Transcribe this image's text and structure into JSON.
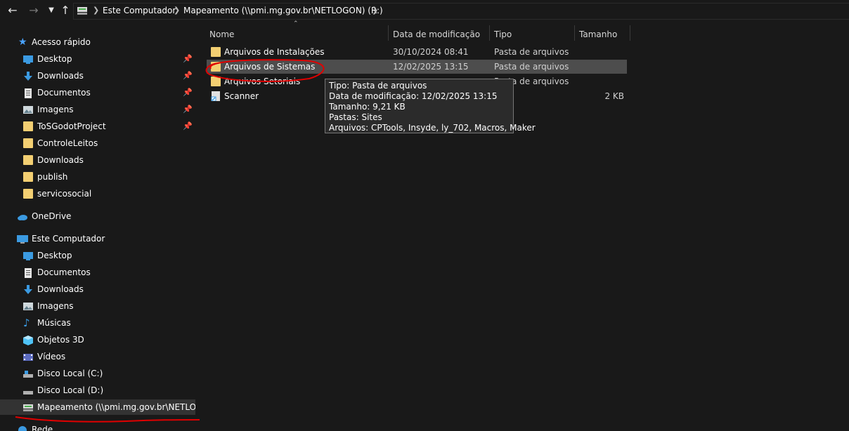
{
  "nav": {
    "back_icon": "arrow-left-icon",
    "forward_icon": "arrow-right-icon",
    "recent_icon": "chevron-down-icon",
    "up_icon": "arrow-up-icon",
    "breadcrumb": [
      "Este Computador",
      "Mapeamento (\\\\pmi.mg.gov.br\\NETLOGON) (R:)"
    ]
  },
  "sidebar": {
    "quick_access": {
      "label": "Acesso rápido",
      "items": [
        {
          "label": "Desktop",
          "icon": "desktop-icon",
          "pinned": true
        },
        {
          "label": "Downloads",
          "icon": "download-icon",
          "pinned": true
        },
        {
          "label": "Documentos",
          "icon": "document-icon",
          "pinned": true
        },
        {
          "label": "Imagens",
          "icon": "pictures-icon",
          "pinned": true
        },
        {
          "label": "ToSGodotProject",
          "icon": "folder-icon",
          "pinned": true
        },
        {
          "label": "ControleLeitos",
          "icon": "folder-icon",
          "pinned": false
        },
        {
          "label": "Downloads",
          "icon": "folder-icon",
          "pinned": false
        },
        {
          "label": "publish",
          "icon": "folder-icon",
          "pinned": false
        },
        {
          "label": "servicosocial",
          "icon": "folder-icon",
          "pinned": false
        }
      ]
    },
    "onedrive": {
      "label": "OneDrive"
    },
    "this_pc": {
      "label": "Este Computador",
      "items": [
        {
          "label": "Desktop",
          "icon": "desktop-icon"
        },
        {
          "label": "Documentos",
          "icon": "document-icon"
        },
        {
          "label": "Downloads",
          "icon": "download-icon"
        },
        {
          "label": "Imagens",
          "icon": "pictures-icon"
        },
        {
          "label": "Músicas",
          "icon": "music-icon"
        },
        {
          "label": "Objetos 3D",
          "icon": "cube-icon"
        },
        {
          "label": "Vídeos",
          "icon": "video-icon"
        },
        {
          "label": "Disco Local (C:)",
          "icon": "drive-icon"
        },
        {
          "label": "Disco Local (D:)",
          "icon": "drive-icon"
        },
        {
          "label": "Mapeamento (\\\\pmi.mg.gov.br\\NETLOGO",
          "icon": "network-drive-icon",
          "selected": true
        }
      ]
    },
    "network": {
      "label": "Rede"
    }
  },
  "columns": {
    "name": "Nome",
    "date": "Data de modificação",
    "type": "Tipo",
    "size": "Tamanho"
  },
  "files": [
    {
      "name": "Arquivos de Instalações",
      "date": "30/10/2024 08:41",
      "type": "Pasta de arquivos",
      "size": ""
    },
    {
      "name": "Arquivos de Sistemas",
      "date": "12/02/2025 13:15",
      "type": "Pasta de arquivos",
      "size": ""
    },
    {
      "name": "Arquivos Setoriais",
      "date": "",
      "type": "Pasta de arquivos",
      "size": ""
    },
    {
      "name": "Scanner",
      "date": "",
      "type": "o",
      "size": "2 KB"
    }
  ],
  "tooltip": {
    "line1": "Tipo: Pasta de arquivos",
    "line2": "Data de modificação: 12/02/2025 13:15",
    "line3": "Tamanho: 9,21 KB",
    "line4": "Pastas: Sites",
    "line5": "Arquivos: CPTools, Insyde, ly_702, Macros, Maker"
  },
  "colors": {
    "background": "#191919",
    "hover_row": "#4d4d4d",
    "selected_sidebar": "#333333",
    "folder": "#f3cf72",
    "annotation": "#e00000"
  }
}
